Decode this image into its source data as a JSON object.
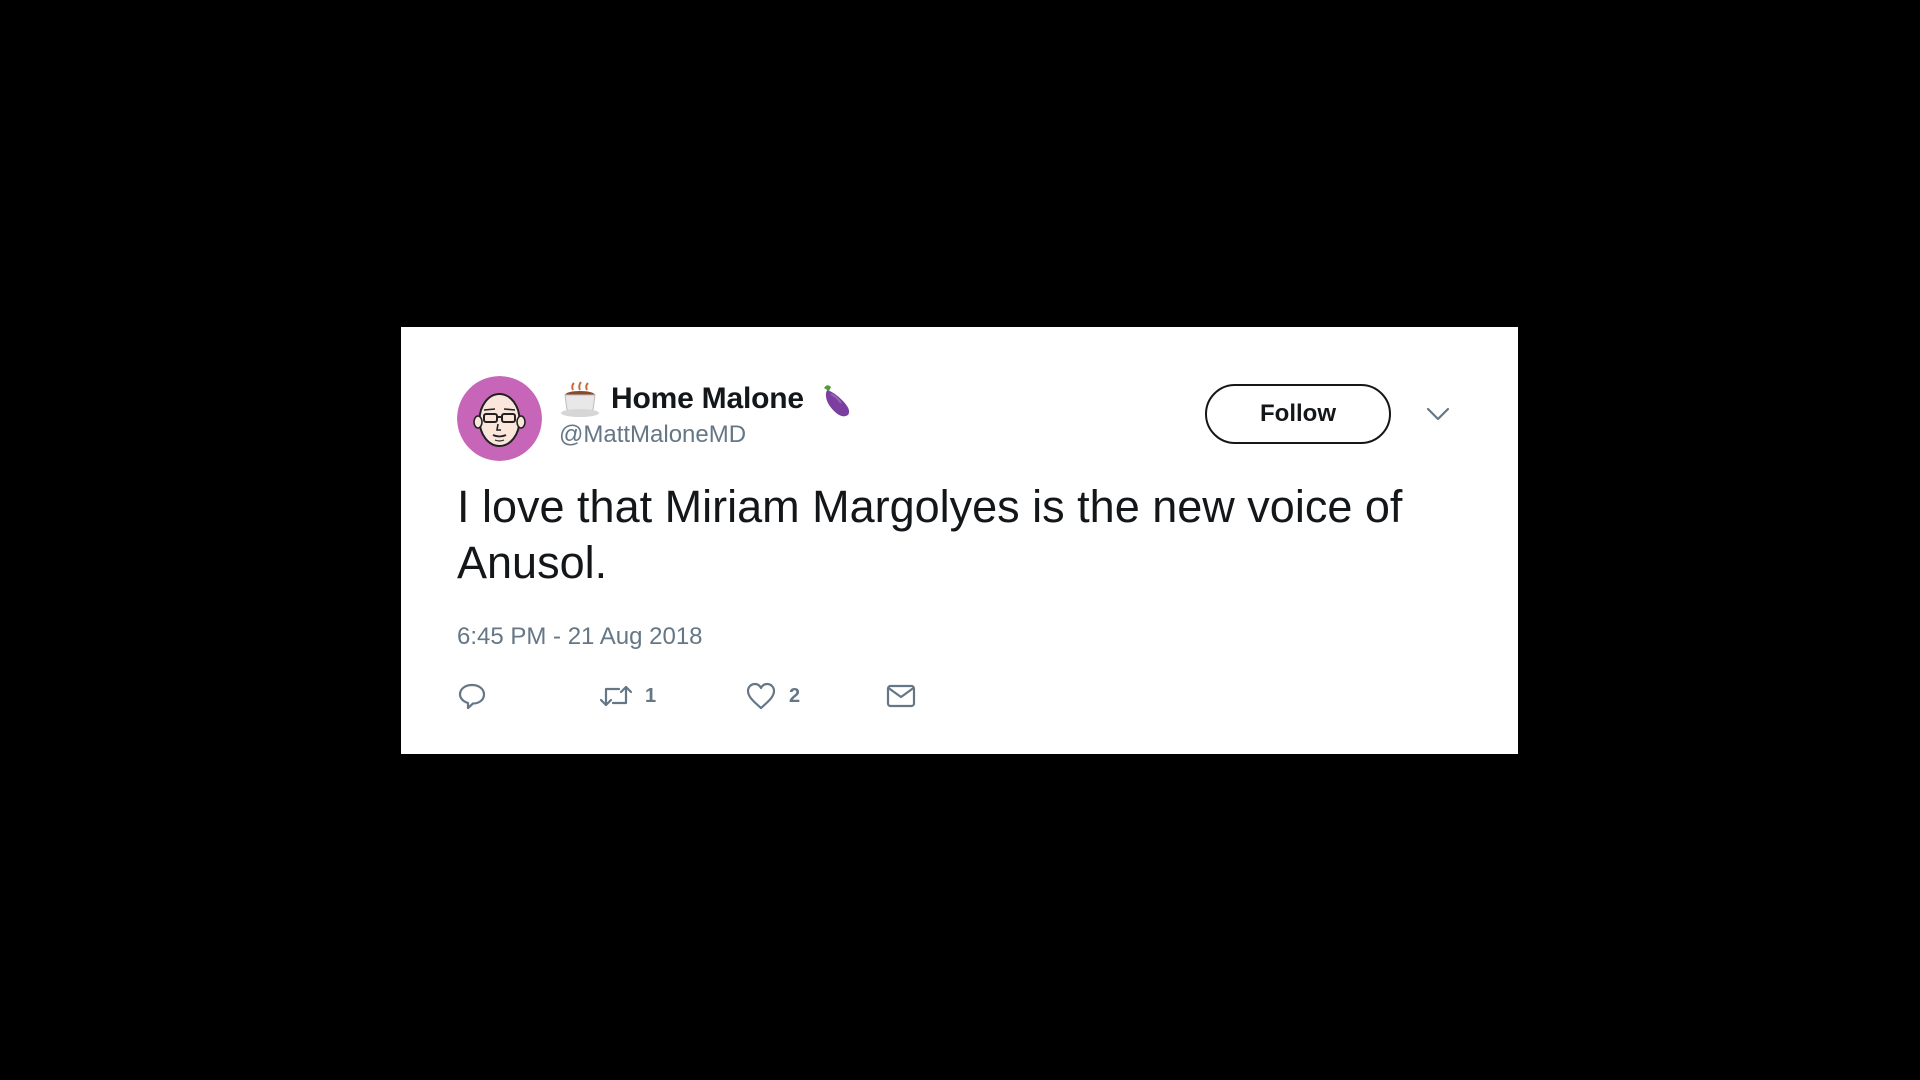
{
  "tweet": {
    "display_name": "Home Malone",
    "handle": "@MattMaloneMD",
    "text": "I love that Miriam Margolyes is the new voice of Anusol.",
    "timestamp": "6:45 PM - 21 Aug 2018",
    "follow_label": "Follow",
    "name_prefix_emoji": "hot-beverage-icon",
    "name_suffix_emoji": "eggplant-icon",
    "actions": {
      "reply_icon": "reply-icon",
      "retweet_icon": "retweet-icon",
      "retweet_count": "1",
      "like_icon": "heart-icon",
      "like_count": "2",
      "dm_icon": "envelope-icon"
    }
  },
  "colors": {
    "background": "#000000",
    "card": "#ffffff",
    "primary_text": "#14171a",
    "secondary_text": "#657786",
    "avatar_bg": "#c766b8"
  }
}
